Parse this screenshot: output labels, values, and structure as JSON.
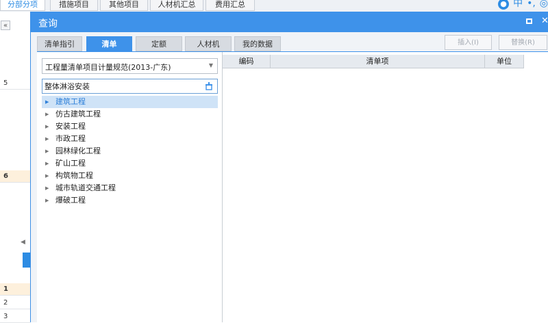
{
  "app": {
    "tabs": [
      "分部分项",
      "措施项目",
      "其他项目",
      "人材机汇总",
      "费用汇总"
    ],
    "active_tab": "分部分项",
    "collapse_glyph": "«",
    "corner_icons": [
      "user-icon",
      "中",
      "dot-icon",
      "settings-icon"
    ],
    "row_labels": [
      "5",
      "6",
      "1",
      "2",
      "3"
    ],
    "scroll_glyph": "◀"
  },
  "dialog": {
    "title": "查询",
    "tabs": [
      "清单指引",
      "清单",
      "定额",
      "人材机",
      "我的数据"
    ],
    "active_tab": "清单",
    "buttons": {
      "insert": "插入(I)",
      "replace": "替换(R)"
    },
    "spec_select": {
      "value": "工程量清单项目计量规范(2013-广东)"
    },
    "search": {
      "value": "整体淋浴安装"
    },
    "tree": [
      {
        "label": "建筑工程",
        "selected": true
      },
      {
        "label": "仿古建筑工程",
        "selected": false
      },
      {
        "label": "安装工程",
        "selected": false
      },
      {
        "label": "市政工程",
        "selected": false
      },
      {
        "label": "园林绿化工程",
        "selected": false
      },
      {
        "label": "矿山工程",
        "selected": false
      },
      {
        "label": "构筑物工程",
        "selected": false
      },
      {
        "label": "城市轨道交通工程",
        "selected": false
      },
      {
        "label": "爆破工程",
        "selected": false
      }
    ],
    "grid_columns": [
      "编码",
      "清单项",
      "单位"
    ]
  },
  "colors": {
    "accent": "#3e92ea",
    "selected_bg": "#cfe3f7",
    "highlight_row": "#fdf0dc"
  }
}
